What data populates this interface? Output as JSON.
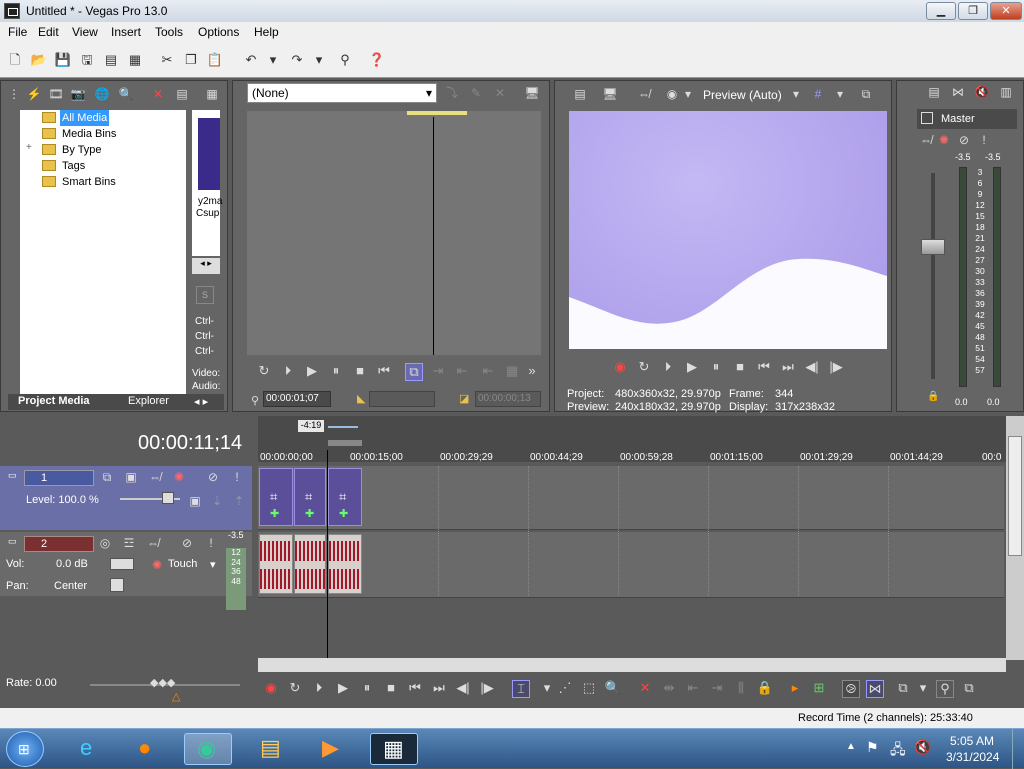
{
  "window": {
    "title": "Untitled * - Vegas Pro 13.0",
    "min": "▁",
    "max": "❐",
    "close": "✕"
  },
  "menu": [
    "File",
    "Edit",
    "View",
    "Insert",
    "Tools",
    "Options",
    "Help"
  ],
  "project_media": {
    "tree": [
      {
        "label": "All Media",
        "selected": true
      },
      {
        "label": "Media Bins"
      },
      {
        "label": "By Type",
        "expand": "+"
      },
      {
        "label": "Tags"
      },
      {
        "label": "Smart Bins"
      }
    ],
    "thumb_name_1": "y2ma",
    "thumb_name_2": "Csup",
    "ctrl_1": "Ctrl-",
    "ctrl_2": "Ctrl-",
    "ctrl_3": "Ctrl-",
    "video_label": "Video:",
    "audio_label": "Audio:",
    "tab_project": "Project Media",
    "tab_explorer": "Explorer"
  },
  "trimmer": {
    "dropdown_value": "(None)",
    "time_in": "00:00:01;07",
    "time_out": "00:00:00;13"
  },
  "preview": {
    "mode": "Preview (Auto)",
    "project_label": "Project:",
    "project_value": "480x360x32, 29.970p",
    "preview_label": "Preview:",
    "preview_value": "240x180x32, 29.970p",
    "frame_label": "Frame:",
    "frame_value": "344",
    "display_label": "Display:",
    "display_value": "317x238x32"
  },
  "mixer": {
    "title": "Master",
    "peak_left": "-3.5",
    "peak_right": "-3.5",
    "scale": [
      "3",
      "6",
      "9",
      "12",
      "15",
      "18",
      "21",
      "24",
      "27",
      "30",
      "33",
      "36",
      "39",
      "42",
      "45",
      "48",
      "51",
      "54",
      "57"
    ],
    "bottom_left": "0.0",
    "bottom_right": "0.0"
  },
  "timeline": {
    "cursor_time": "00:00:11;14",
    "region_label": "-4:19",
    "ruler": [
      "00:00:00;00",
      "00:00:15;00",
      "00:00:29;29",
      "00:00:44;29",
      "00:00:59;28",
      "00:01:15;00",
      "00:01:29;29",
      "00:01:44;29",
      "00:0"
    ],
    "video_track": {
      "number": "1",
      "level_label": "Level: 100.0 %"
    },
    "audio_track": {
      "number": "2",
      "vol_label": "Vol:",
      "vol_value": "0.0 dB",
      "pan_label": "Pan:",
      "pan_value": "Center",
      "mode": "Touch",
      "peak": "-3.5",
      "meter": [
        "12",
        "24",
        "36",
        "48"
      ]
    }
  },
  "transport": {
    "rate": "Rate: 0.00"
  },
  "status": {
    "record_time": "Record Time (2 channels): 25:33:40"
  },
  "taskbar": {
    "time": "5:05 AM",
    "date": "3/31/2024"
  },
  "colors": {
    "accent": "#3399ff",
    "panel": "#656565",
    "preview_bg": "#b8a8f0"
  }
}
